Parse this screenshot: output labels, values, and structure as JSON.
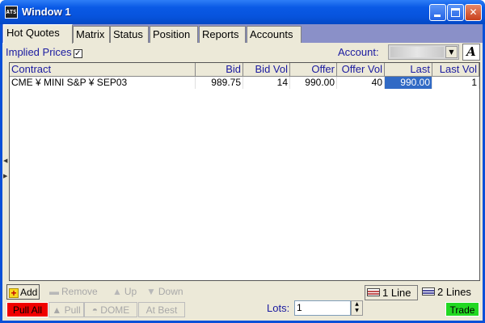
{
  "window": {
    "title": "Window 1",
    "icon_label": "ATS"
  },
  "tabs": [
    {
      "label": "Hot Quotes",
      "active": true
    },
    {
      "label": "Matrix"
    },
    {
      "label": "Status"
    },
    {
      "label": "Position"
    },
    {
      "label": "Reports"
    },
    {
      "label": "Accounts"
    }
  ],
  "options": {
    "implied_prices_label": "Implied Prices",
    "implied_prices_checked": true,
    "account_label": "Account:",
    "account_value": "",
    "font_button": "A"
  },
  "grid": {
    "columns": [
      "Contract",
      "Bid",
      "Bid Vol",
      "Offer",
      "Offer Vol",
      "Last",
      "Last Vol"
    ],
    "rows": [
      {
        "contract": "CME ¥ MINI S&P ¥ SEP03",
        "bid": "989.75",
        "bid_vol": "14",
        "offer": "990.00",
        "offer_vol": "40",
        "last": "990.00",
        "last_vol": "1"
      }
    ]
  },
  "toolbar": {
    "add": "Add",
    "remove": "Remove",
    "up": "Up",
    "down": "Down",
    "one_line": "1 Line",
    "two_lines": "2 Lines",
    "pull_all": "Pull All",
    "pull": "Pull",
    "dome": "DOME",
    "at_best": "At Best",
    "lots_label": "Lots:",
    "lots_value": "1",
    "trade": "Trade"
  },
  "colors": {
    "pull_all": "#f00000",
    "trade": "#22d822",
    "selection": "#316ac5",
    "label_blue": "#1a1aa0"
  },
  "icons": {
    "app": "ats-app-icon",
    "add": "plus-icon",
    "remove": "minus-icon",
    "up": "up-arrow-icon",
    "down": "down-arrow-icon",
    "account_dropdown": "chevron-down-icon"
  }
}
